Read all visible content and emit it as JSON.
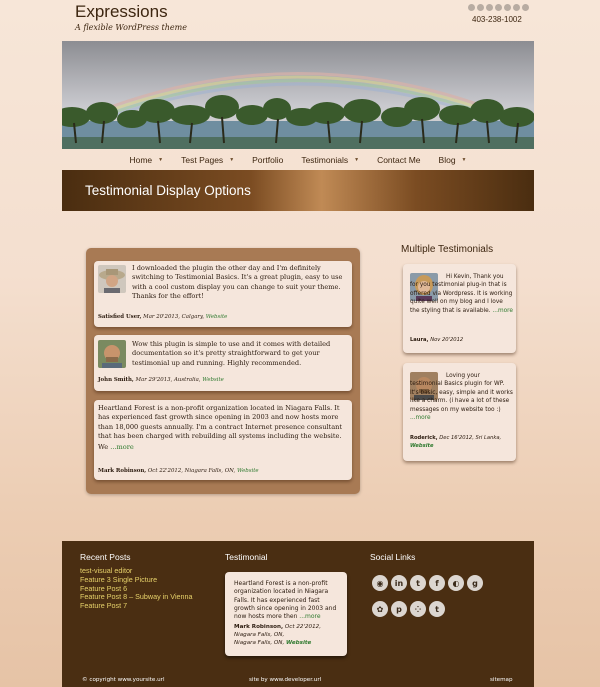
{
  "site": {
    "title": "Expressions",
    "tagline": "A flexible WordPress theme",
    "phone": "403-238-1002"
  },
  "nav": [
    {
      "label": "Home",
      "arrow": true
    },
    {
      "label": "Test Pages",
      "arrow": true
    },
    {
      "label": "Portfolio",
      "arrow": false
    },
    {
      "label": "Testimonials",
      "arrow": true
    },
    {
      "label": "Contact Me",
      "arrow": false
    },
    {
      "label": "Blog",
      "arrow": true
    }
  ],
  "page_title": "Testimonial Display Options",
  "testimonials": [
    {
      "text": "I downloaded the plugin the other day and I'm definitely switching to Testimonial Basics. It's a great plugin, easy to use with a cool custom display you can change to suit your theme. Thanks for the effort!",
      "name": "Satisfied User,",
      "meta": "Mar 20'2013, Calgary,",
      "link": "Website"
    },
    {
      "text": "Wow this plugin is simple to use and it comes with detailed documentation so it's pretty straightforward to get your testimonial up and running. Highly recommended.",
      "name": "John Smith,",
      "meta": "Mar 29'2013, Australia,",
      "link": "Website"
    },
    {
      "text": "Heartland Forest is a non-profit organization located in Niagara Falls. It has experienced fast growth since opening in 2003 and now hosts more than 18,000 guests annually. I'm a contract Internet presence consultant that has been charged with rebuilding all systems including the website.",
      "we": "We",
      "more": "...more",
      "name": "Mark Robinson,",
      "meta": "Oct 22'2012, Niagara Falls, ON,",
      "link": "Website"
    }
  ],
  "sidebar": {
    "title": "Multiple Testimonials",
    "items": [
      {
        "text": "Hi Kevin, Thank you for you testimonial plug-in that is offered via Wordpress. It is working quite well on my blog and I love the styling that is available.",
        "more": "...more",
        "name": "Laura,",
        "meta": "Nov 20'2012"
      },
      {
        "text": "Loving your testimonial Basics plugin for WP. It's basic, easy, simple and it works like a charm. (i have a lot of these messages on my website too :)",
        "more": "...more",
        "name": "Roderick,",
        "meta": "Dec 16'2012, Sri Lanka,",
        "link": "Website"
      }
    ]
  },
  "footer": {
    "recent_posts_title": "Recent Posts",
    "recent_posts": [
      "test-visual editor",
      "Feature 3 Single Picture",
      "Feature Post 6",
      "Feature Post 8 – Subway in Vienna",
      "Feature Post 7"
    ],
    "testimonial_title": "Testimonial",
    "testimonial": {
      "text": "Heartland Forest is a non-profit organization located in Niagara Falls. It has experienced fast growth since opening in 2003 and now hosts more then",
      "more": "...more",
      "name": "Mark Robinson,",
      "meta": "Oct 22'2012, Niagara Falls, ON,",
      "link": "Website"
    },
    "social_title": "Social Links",
    "social_icons": [
      "rss-icon",
      "linkedin-icon",
      "twitter-icon",
      "facebook-icon",
      "picasa-icon",
      "google-plus-icon",
      "flickr-icon",
      "pinterest-icon",
      "myspace-icon",
      "tumblr-icon"
    ],
    "copyright": "© copyright www.yoursite.url",
    "credit": "site by www.developer.url",
    "sitemap": "sitemap"
  },
  "colors": {
    "brown_dark": "#4a2e12",
    "accent_link": "#2f7a2f",
    "footer_link": "#e7d26a",
    "card_bg": "#f5e6dc"
  }
}
